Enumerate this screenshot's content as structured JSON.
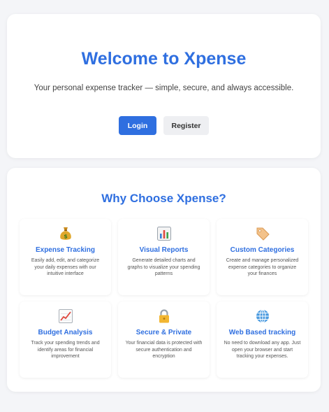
{
  "hero": {
    "title": "Welcome to Xpense",
    "subtitle": "Your personal expense tracker — simple, secure, and always accessible.",
    "login_label": "Login",
    "register_label": "Register"
  },
  "why": {
    "title": "Why Choose Xpense?",
    "features": [
      {
        "icon": "money-bag-icon",
        "title": "Expense Tracking",
        "desc": "Easily add, edit, and categorize your daily expenses with our intuitive interface"
      },
      {
        "icon": "bar-chart-icon",
        "title": "Visual Reports",
        "desc": "Generate detailed charts and graphs to visualize your spending patterns"
      },
      {
        "icon": "tag-icon",
        "title": "Custom Categories",
        "desc": "Create and manage personalized expense categories to organize your finances"
      },
      {
        "icon": "trend-chart-icon",
        "title": "Budget Analysis",
        "desc": "Track your spending trends and identify areas for financial improvement"
      },
      {
        "icon": "lock-icon",
        "title": "Secure & Private",
        "desc": "Your financial data is protected with secure authentication and encryption"
      },
      {
        "icon": "globe-icon",
        "title": "Web Based tracking",
        "desc": "No need to download any app. Just open your browser and start tracking your expenses."
      }
    ]
  },
  "colors": {
    "accent": "#2f6fe0",
    "background": "#f4f5f8"
  }
}
